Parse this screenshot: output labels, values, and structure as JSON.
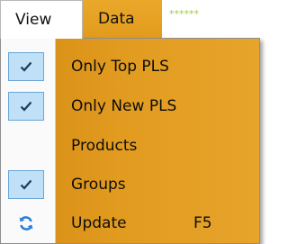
{
  "menubar": {
    "view_label": "View",
    "data_label": "Data",
    "stars": "******"
  },
  "view_menu": {
    "items": [
      {
        "label": "Only Top PLS",
        "checked": true,
        "icon": "check-icon"
      },
      {
        "label": "Only New PLS",
        "checked": true,
        "icon": "check-icon"
      },
      {
        "label": "Products",
        "checked": false,
        "icon": ""
      },
      {
        "label": "Groups",
        "checked": true,
        "icon": "check-icon"
      },
      {
        "label": "Update",
        "checked": false,
        "icon": "refresh-icon",
        "shortcut": "F5"
      }
    ]
  },
  "colors": {
    "menu_accent": "#e29b1c",
    "check_bg": "#bfe0f6",
    "check_border": "#6aa6d6",
    "refresh_icon": "#2c7fd8"
  }
}
